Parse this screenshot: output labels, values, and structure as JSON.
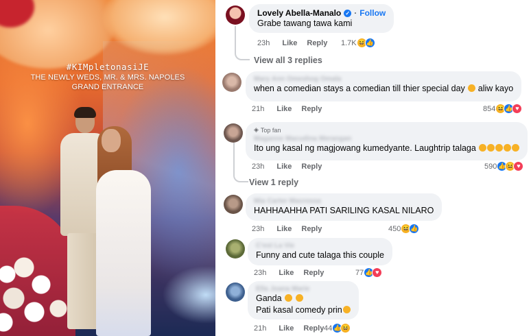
{
  "photo": {
    "hashtag": "#KIMpletonasiJE",
    "caption_line1": "THE NEWLY WEDS, MR. & MRS. NAPOLES",
    "caption_line2": "GRAND ENTRANCE"
  },
  "top_comment": {
    "name": "Lovely Abella-Manalo",
    "follow_label": "Follow",
    "text": "Grabe tawang tawa kami",
    "time": "23h",
    "like_label": "Like",
    "reply_label": "Reply",
    "reaction_count": "1.7K",
    "view_replies": "View all 3 replies"
  },
  "comments": [
    {
      "name": "Mary Ann Omeshog Omala",
      "text": "when a comedian stays a comedian till thier special day",
      "text_suffix": "aliw kayo",
      "time": "21h",
      "like_label": "Like",
      "reply_label": "Reply",
      "reaction_count": "854"
    },
    {
      "badge": "Top fan",
      "name": "Maganne Macudina Merangan",
      "text": "Ito ung kasal ng magjowang kumedyante. Laughtrip talaga",
      "time": "23h",
      "like_label": "Like",
      "reply_label": "Reply",
      "reaction_count": "590",
      "view_replies": "View 1 reply"
    },
    {
      "name": "Mia Carter Macrossa",
      "text": "HAHHAAHHA PATI SARILING KASAL NILARO",
      "time": "23h",
      "like_label": "Like",
      "reply_label": "Reply",
      "reaction_count": "450"
    },
    {
      "name": "C'est La Vie",
      "text": "Funny and cute talaga this couple",
      "time": "23h",
      "like_label": "Like",
      "reply_label": "Reply",
      "reaction_count": "77"
    },
    {
      "name": "Ella Joana Marie",
      "text": "Ganda",
      "text_line2": "Pati kasal comedy prin",
      "time": "21h",
      "like_label": "Like",
      "reply_label": "Reply",
      "reaction_count": "44"
    }
  ],
  "colors": {
    "bubble": "#f0f2f5",
    "meta": "#65676b",
    "link_blue": "#1877f2",
    "haha": "#f7b125",
    "love": "#f33e58"
  }
}
